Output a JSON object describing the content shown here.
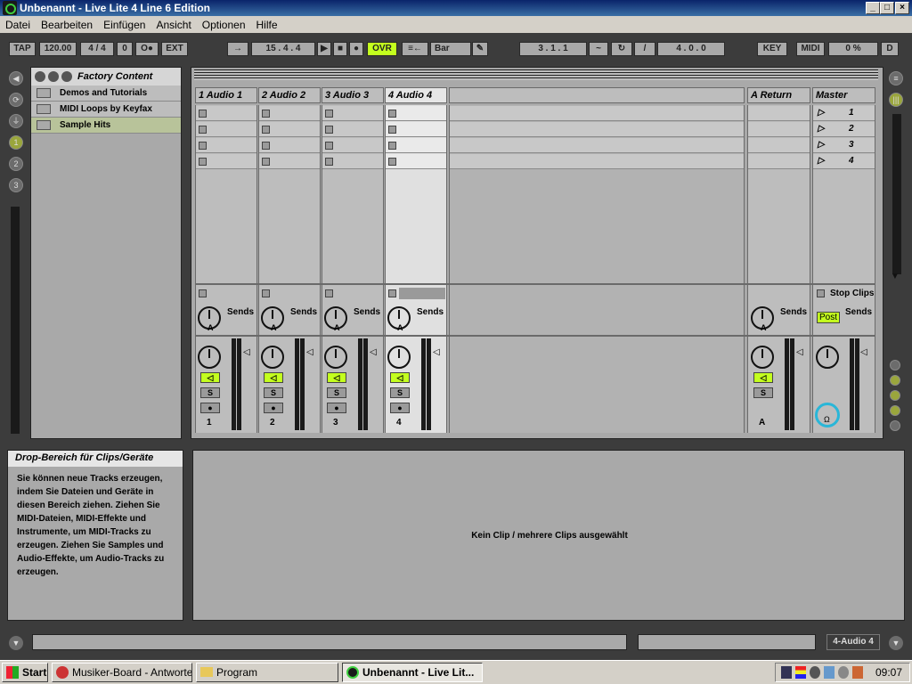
{
  "window": {
    "title": "Unbenannt - Live Lite 4 Line 6 Edition",
    "min": "_",
    "max": "□",
    "close": "×"
  },
  "menu": [
    "Datei",
    "Bearbeiten",
    "Einfügen",
    "Ansicht",
    "Optionen",
    "Hilfe"
  ],
  "transport": {
    "tap": "TAP",
    "tempo": "120.00",
    "signature": "4 / 4",
    "quantize": "0",
    "metro": "O●",
    "ext": "EXT",
    "position": "15 . 4 . 4",
    "ovr": "OVR",
    "quant_menu": "Bar",
    "loop_start": "3 . 1 . 1",
    "loop_len": "4 . 0 . 0",
    "key": "KEY",
    "midi": "MIDI",
    "cpu": "0 %",
    "disk": "D"
  },
  "browser": {
    "title": "Factory Content",
    "items": [
      "Demos and Tutorials",
      "MIDI Loops by Keyfax",
      "Sample Hits"
    ]
  },
  "tracks": [
    {
      "name": "1 Audio 1",
      "num": "1"
    },
    {
      "name": "2 Audio 2",
      "num": "2"
    },
    {
      "name": "3 Audio 3",
      "num": "3"
    },
    {
      "name": "4 Audio 4",
      "num": "4"
    }
  ],
  "return": {
    "name": "A Return",
    "letter": "A"
  },
  "master": {
    "name": "Master",
    "scenes": [
      "1",
      "2",
      "3",
      "4"
    ],
    "stop_clips": "Stop Clips",
    "post": "Post"
  },
  "labels": {
    "sends": "Sends",
    "send_a": "A",
    "solo": "S"
  },
  "info": {
    "title": "Drop-Bereich für Clips/Geräte",
    "body": "Sie können neue Tracks erzeugen, indem Sie Dateien und Geräte in diesen Bereich ziehen. Ziehen Sie MIDI-Dateien, MIDI-Effekte und Instrumente, um MIDI-Tracks zu erzeugen. Ziehen Sie Samples und Audio-Effekte, um Audio-Tracks zu erzeugen."
  },
  "detail": {
    "empty": "Kein Clip / mehrere Clips ausgewählt"
  },
  "status": {
    "selected_track": "4-Audio 4"
  },
  "taskbar": {
    "start": "Start",
    "items": [
      "Musiker-Board - Antworte...",
      "Program",
      "Unbenannt - Live Lit..."
    ],
    "clock": "09:07"
  },
  "colors": {
    "accent": "#c3ff1e",
    "panel": "#a9a9a9",
    "bg": "#3c3c3c"
  }
}
